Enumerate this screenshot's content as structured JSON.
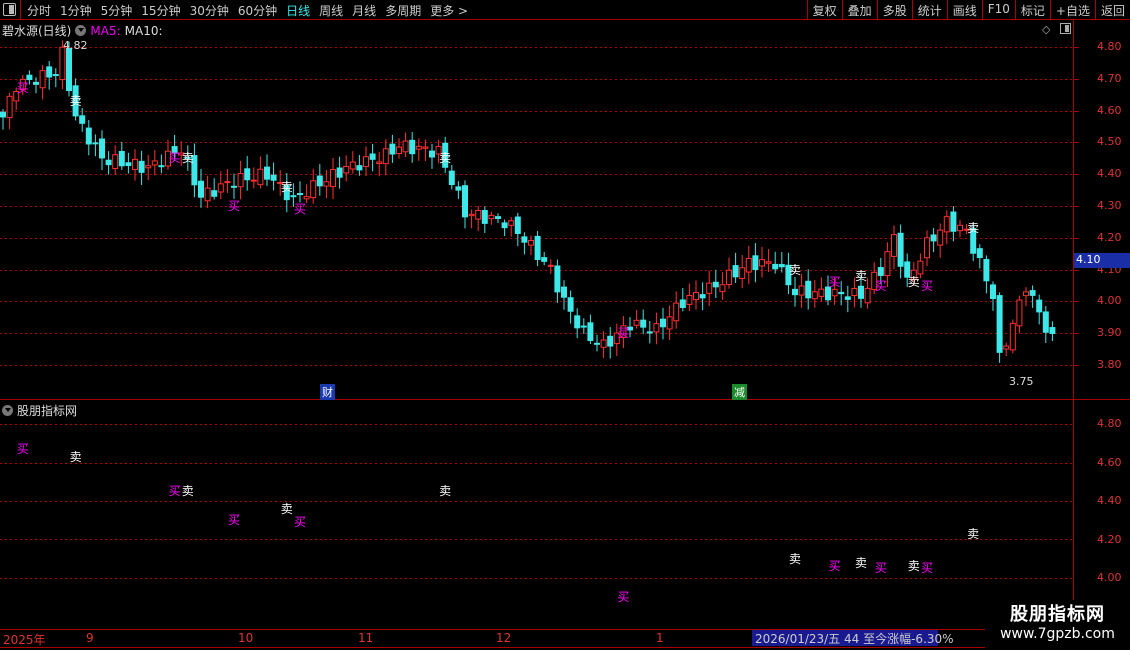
{
  "toolbar": {
    "periods": [
      "分时",
      "1分钟",
      "5分钟",
      "15分钟",
      "30分钟",
      "60分钟",
      "日线",
      "周线",
      "月线",
      "多周期",
      "更多 >"
    ],
    "active_period": "日线",
    "right_buttons": [
      "复权",
      "叠加",
      "多股",
      "统计",
      "画线",
      "F10",
      "标记",
      "+自选",
      "返回"
    ]
  },
  "header": {
    "stock": "碧水源(日线)",
    "ma5": "MA5:",
    "ma10": "MA10:"
  },
  "main_axis": {
    "labels": [
      "4.80",
      "4.70",
      "4.60",
      "4.50",
      "4.40",
      "4.30",
      "4.20",
      "4.10",
      "4.00",
      "3.90",
      "3.80"
    ],
    "current_price": "4.10"
  },
  "sub_panel": {
    "title": "股朋指标网",
    "labels": [
      "4.80",
      "4.60",
      "4.40",
      "4.20",
      "4.00"
    ]
  },
  "annotations": {
    "high": "4.82",
    "low": "3.75",
    "badge_cai": "财",
    "badge_jian": "减"
  },
  "time_axis": {
    "labels": [
      "2025年",
      "9",
      "10",
      "11",
      "12",
      "1"
    ],
    "status": "2026/01/23/五 44 至今涨幅-6.30%"
  },
  "watermark": {
    "name": "股朋指标网",
    "url": "www.7gpzb.com"
  },
  "colors": {
    "up": "#ff3030",
    "down": "#3ee8e8",
    "buy": "#ff00ff",
    "sell": "#ffffff",
    "grid": "#aa0000"
  },
  "chart_data": {
    "type": "candlestick",
    "count": 160,
    "close_keypoints": [
      [
        0,
        4.58
      ],
      [
        2,
        4.68
      ],
      [
        8,
        4.72
      ],
      [
        9,
        4.78
      ],
      [
        10,
        4.68
      ],
      [
        11,
        4.58
      ],
      [
        15,
        4.45
      ],
      [
        22,
        4.42
      ],
      [
        27,
        4.48
      ],
      [
        30,
        4.33
      ],
      [
        35,
        4.38
      ],
      [
        40,
        4.4
      ],
      [
        44,
        4.32
      ],
      [
        47,
        4.36
      ],
      [
        52,
        4.42
      ],
      [
        58,
        4.46
      ],
      [
        60,
        4.49
      ],
      [
        66,
        4.47
      ],
      [
        68,
        4.38
      ],
      [
        70,
        4.28
      ],
      [
        76,
        4.25
      ],
      [
        78,
        4.22
      ],
      [
        83,
        4.1
      ],
      [
        85,
        4.0
      ],
      [
        88,
        3.9
      ],
      [
        91,
        3.86
      ],
      [
        95,
        3.93
      ],
      [
        99,
        3.91
      ],
      [
        103,
        4.0
      ],
      [
        108,
        4.05
      ],
      [
        113,
        4.12
      ],
      [
        117,
        4.12
      ],
      [
        120,
        4.03
      ],
      [
        130,
        4.02
      ],
      [
        133,
        4.1
      ],
      [
        135,
        4.2
      ],
      [
        137,
        4.06
      ],
      [
        140,
        4.18
      ],
      [
        143,
        4.25
      ],
      [
        146,
        4.22
      ],
      [
        150,
        4.02
      ],
      [
        151,
        3.82
      ],
      [
        153,
        3.93
      ],
      [
        155,
        4.05
      ],
      [
        158,
        3.92
      ],
      [
        159,
        3.88
      ]
    ],
    "signals": [
      {
        "i": 3,
        "t": "买",
        "v": 4.67
      },
      {
        "i": 11,
        "t": "卖",
        "v": 4.63
      },
      {
        "i": 26,
        "t": "买",
        "v": 4.45
      },
      {
        "i": 28,
        "t": "卖",
        "v": 4.45
      },
      {
        "i": 35,
        "t": "买",
        "v": 4.3
      },
      {
        "i": 43,
        "t": "卖",
        "v": 4.36
      },
      {
        "i": 45,
        "t": "买",
        "v": 4.29
      },
      {
        "i": 67,
        "t": "卖",
        "v": 4.45
      },
      {
        "i": 94,
        "t": "买",
        "v": 3.9
      },
      {
        "i": 120,
        "t": "卖",
        "v": 4.1
      },
      {
        "i": 126,
        "t": "买",
        "v": 4.06
      },
      {
        "i": 130,
        "t": "卖",
        "v": 4.08
      },
      {
        "i": 133,
        "t": "买",
        "v": 4.05
      },
      {
        "i": 138,
        "t": "卖",
        "v": 4.06
      },
      {
        "i": 140,
        "t": "买",
        "v": 4.05
      },
      {
        "i": 147,
        "t": "卖",
        "v": 4.23
      }
    ]
  }
}
